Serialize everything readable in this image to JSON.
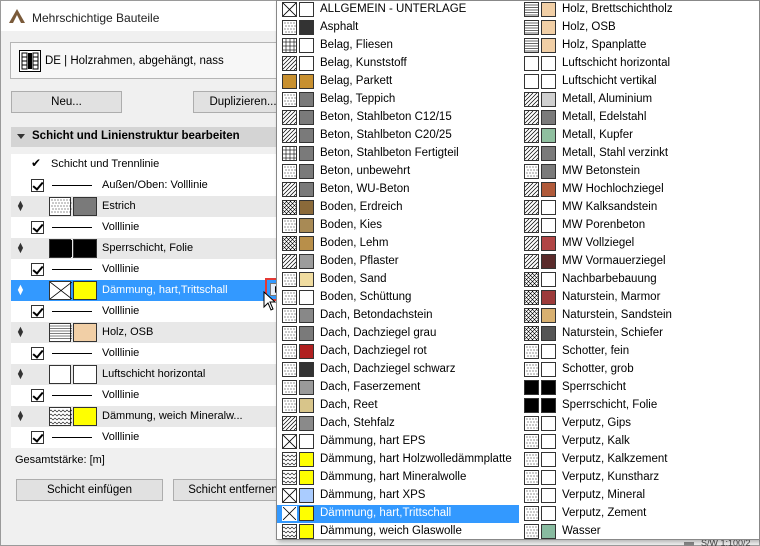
{
  "window": {
    "title": "Mehrschichtige Bauteile"
  },
  "preset": {
    "label": "DE | Holzrahmen, abgehängt, nass"
  },
  "buttons": {
    "new": "Neu...",
    "duplicate": "Duplizieren...",
    "insert": "Schicht einfügen",
    "remove": "Schicht entfernen"
  },
  "section": {
    "label": "Schicht und Linienstruktur bearbeiten"
  },
  "layers": {
    "header": "Schicht und Trennlinie",
    "rows": [
      {
        "kind": "line",
        "text": "Außen/Oben: Volllinie"
      },
      {
        "kind": "layer",
        "text": "Estrich",
        "pattern": "dots",
        "cut": "#7a7a7a"
      },
      {
        "kind": "line",
        "text": "Volllinie"
      },
      {
        "kind": "layer",
        "text": "Sperrschicht, Folie",
        "pattern": "solid-black",
        "cut": "#000000"
      },
      {
        "kind": "line",
        "text": "Volllinie"
      },
      {
        "kind": "layer",
        "text": "Dämmung, hart,Trittschall",
        "pattern": "cross",
        "cut": "#ffff00",
        "selected": true
      },
      {
        "kind": "line",
        "text": "Volllinie"
      },
      {
        "kind": "layer",
        "text": "Holz, OSB",
        "pattern": "hlines",
        "cut": "#f1cfa6"
      },
      {
        "kind": "line",
        "text": "Volllinie"
      },
      {
        "kind": "layer",
        "text": "Luftschicht horizontal",
        "pattern": "empty",
        "cut": "#ffffff"
      },
      {
        "kind": "line",
        "text": "Volllinie"
      },
      {
        "kind": "layer",
        "text": "Dämmung, weich Mineralw...",
        "pattern": "wave",
        "cut": "#ffff00"
      },
      {
        "kind": "line",
        "text": "Volllinie"
      }
    ]
  },
  "total": {
    "label": "Gesamtstärke: [m]"
  },
  "status": {
    "scale": "S/W 1:100/2"
  },
  "materials": {
    "left": [
      {
        "label": "ALLGEMEIN - UNTERLAGE",
        "pattern": "cross",
        "color": "#ffffff"
      },
      {
        "label": "Asphalt",
        "pattern": "dots",
        "color": "#333333"
      },
      {
        "label": "Belag, Fliesen",
        "pattern": "grid",
        "color": "#ffffff"
      },
      {
        "label": "Belag, Kunststoff",
        "pattern": "diag",
        "color": "#ffffff"
      },
      {
        "label": "Belag, Parkett",
        "pattern": "solid-brown",
        "color": "#c8902f"
      },
      {
        "label": "Belag, Teppich",
        "pattern": "dots",
        "color": "#7a7a7a"
      },
      {
        "label": "Beton, Stahlbeton C12/15",
        "pattern": "diag",
        "color": "#7a7a7a"
      },
      {
        "label": "Beton, Stahlbeton C20/25",
        "pattern": "diag",
        "color": "#7a7a7a"
      },
      {
        "label": "Beton, Stahlbeton Fertigteil",
        "pattern": "grid",
        "color": "#7a7a7a"
      },
      {
        "label": "Beton, unbewehrt",
        "pattern": "dots",
        "color": "#7a7a7a"
      },
      {
        "label": "Beton, WU-Beton",
        "pattern": "diag",
        "color": "#7a7a7a"
      },
      {
        "label": "Boden, Erdreich",
        "pattern": "crosshatch",
        "color": "#8b6a3a"
      },
      {
        "label": "Boden, Kies",
        "pattern": "dots",
        "color": "#a88a55"
      },
      {
        "label": "Boden, Lehm",
        "pattern": "crosshatch",
        "color": "#b88f4a"
      },
      {
        "label": "Boden, Pflaster",
        "pattern": "diag",
        "color": "#9c9c9c"
      },
      {
        "label": "Boden, Sand",
        "pattern": "dots",
        "color": "#f0dca0"
      },
      {
        "label": "Boden, Schüttung",
        "pattern": "dots",
        "color": "#ffffff"
      },
      {
        "label": "Dach, Betondachstein",
        "pattern": "dots",
        "color": "#888888"
      },
      {
        "label": "Dach, Dachziegel grau",
        "pattern": "dots",
        "color": "#7a7a7a"
      },
      {
        "label": "Dach, Dachziegel rot",
        "pattern": "dots",
        "color": "#b02020"
      },
      {
        "label": "Dach, Dachziegel schwarz",
        "pattern": "dots",
        "color": "#333333"
      },
      {
        "label": "Dach, Faserzement",
        "pattern": "dots",
        "color": "#9a9a9a"
      },
      {
        "label": "Dach, Reet",
        "pattern": "dots",
        "color": "#d8c58a"
      },
      {
        "label": "Dach, Stehfalz",
        "pattern": "diag",
        "color": "#8a8a8a"
      },
      {
        "label": "Dämmung, hart EPS",
        "pattern": "cross",
        "color": "#ffffff"
      },
      {
        "label": "Dämmung, hart Holzwolledämmplatte",
        "pattern": "wave",
        "color": "#ffff00"
      },
      {
        "label": "Dämmung, hart Mineralwolle",
        "pattern": "wave",
        "color": "#ffff00"
      },
      {
        "label": "Dämmung, hart XPS",
        "pattern": "cross",
        "color": "#aaccff"
      },
      {
        "label": "Dämmung, hart,Trittschall",
        "pattern": "cross",
        "color": "#ffff00",
        "selected": true
      },
      {
        "label": "Dämmung, weich Glaswolle",
        "pattern": "wave",
        "color": "#ffff00"
      }
    ],
    "right": [
      {
        "label": "Holz, Brettschichtholz",
        "pattern": "hlines",
        "color": "#f1cfa6"
      },
      {
        "label": "Holz, OSB",
        "pattern": "hlines",
        "color": "#f1cfa6"
      },
      {
        "label": "Holz, Spanplatte",
        "pattern": "hlines",
        "color": "#f1cfa6"
      },
      {
        "label": "Luftschicht horizontal",
        "pattern": "empty",
        "color": "#ffffff"
      },
      {
        "label": "Luftschicht vertikal",
        "pattern": "empty",
        "color": "#ffffff"
      },
      {
        "label": "Metall, Aluminium",
        "pattern": "diag",
        "color": "#d0d0d0"
      },
      {
        "label": "Metall, Edelstahl",
        "pattern": "diag",
        "color": "#7a7a7a"
      },
      {
        "label": "Metall, Kupfer",
        "pattern": "diag",
        "color": "#8fbf9f"
      },
      {
        "label": "Metall, Stahl verzinkt",
        "pattern": "diag",
        "color": "#7a7a7a"
      },
      {
        "label": "MW Betonstein",
        "pattern": "dots",
        "color": "#7a7a7a"
      },
      {
        "label": "MW Hochlochziegel",
        "pattern": "diag",
        "color": "#b05a3a"
      },
      {
        "label": "MW Kalksandstein",
        "pattern": "diag",
        "color": "#ffffff"
      },
      {
        "label": "MW Porenbeton",
        "pattern": "diag",
        "color": "#ffffff"
      },
      {
        "label": "MW Vollziegel",
        "pattern": "diag",
        "color": "#b04545"
      },
      {
        "label": "MW Vormauerziegel",
        "pattern": "diag",
        "color": "#5a2a2a"
      },
      {
        "label": "Nachbarbebauung",
        "pattern": "crosshatch",
        "color": "#ffffff"
      },
      {
        "label": "Naturstein, Marmor",
        "pattern": "crosshatch",
        "color": "#9c3a3a"
      },
      {
        "label": "Naturstein, Sandstein",
        "pattern": "crosshatch",
        "color": "#d8b070"
      },
      {
        "label": "Naturstein, Schiefer",
        "pattern": "crosshatch",
        "color": "#555555"
      },
      {
        "label": "Schotter, fein",
        "pattern": "dots",
        "color": "#ffffff"
      },
      {
        "label": "Schotter, grob",
        "pattern": "dots",
        "color": "#ffffff"
      },
      {
        "label": "Sperrschicht",
        "pattern": "solid-black",
        "color": "#000000"
      },
      {
        "label": "Sperrschicht, Folie",
        "pattern": "solid-black",
        "color": "#000000"
      },
      {
        "label": "Verputz, Gips",
        "pattern": "dots",
        "color": "#ffffff"
      },
      {
        "label": "Verputz, Kalk",
        "pattern": "dots",
        "color": "#ffffff"
      },
      {
        "label": "Verputz, Kalkzement",
        "pattern": "dots",
        "color": "#ffffff"
      },
      {
        "label": "Verputz, Kunstharz",
        "pattern": "dots",
        "color": "#ffffff"
      },
      {
        "label": "Verputz, Mineral",
        "pattern": "dots",
        "color": "#ffffff"
      },
      {
        "label": "Verputz, Zement",
        "pattern": "dots",
        "color": "#ffffff"
      },
      {
        "label": "Wasser",
        "pattern": "dots",
        "color": "#88bba0"
      }
    ]
  }
}
